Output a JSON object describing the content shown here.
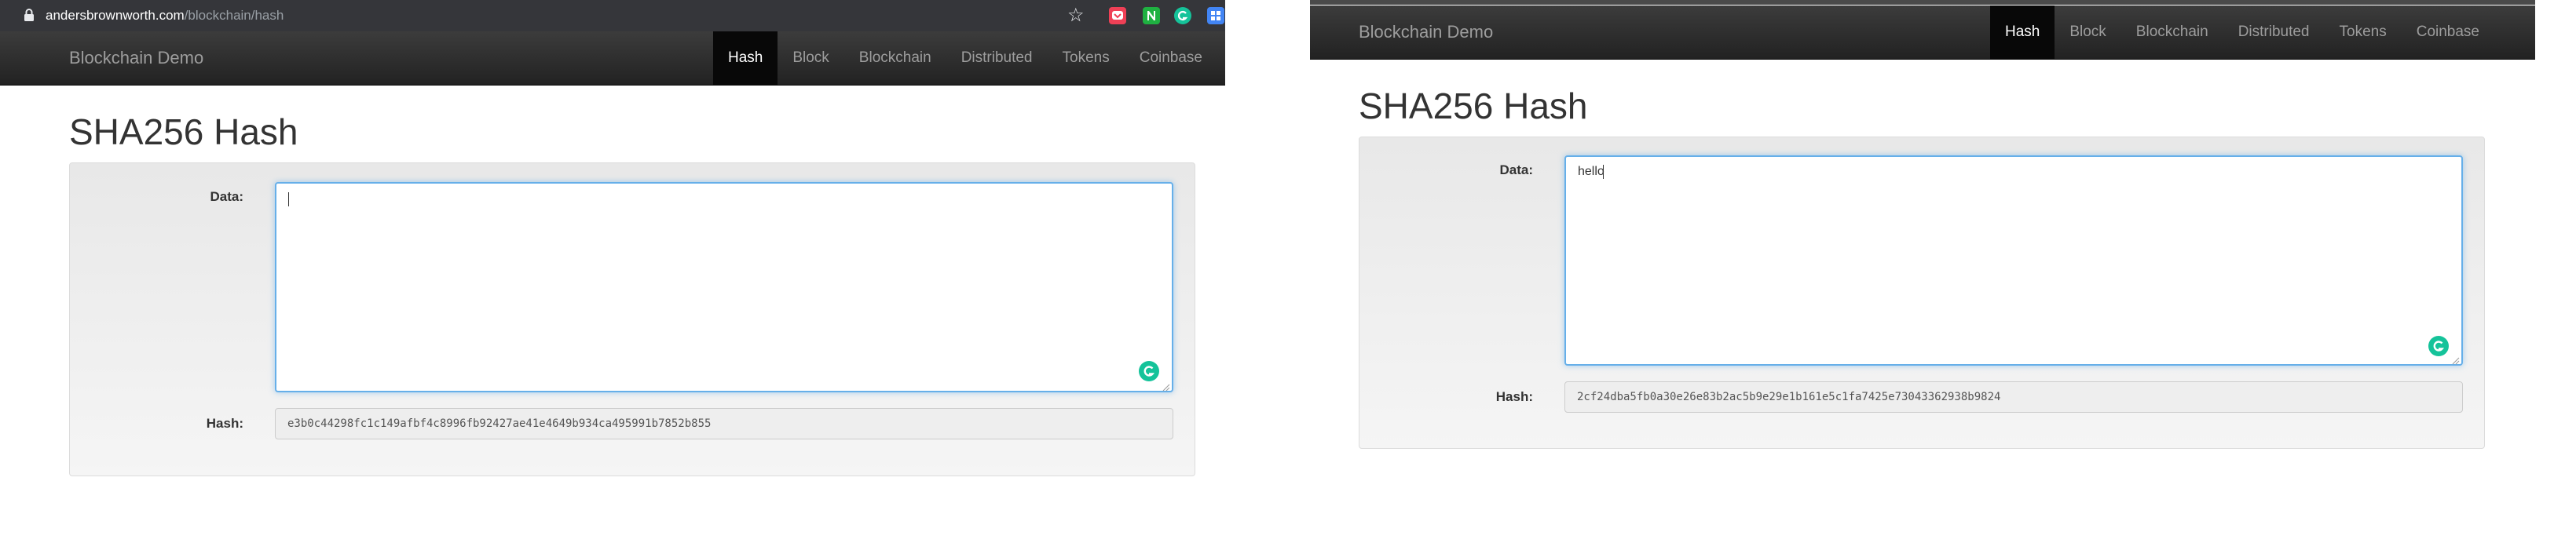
{
  "left": {
    "browser": {
      "url_host": "andersbrownworth.com",
      "url_path": "/blockchain/hash"
    },
    "navbar": {
      "brand": "Blockchain Demo",
      "items": [
        {
          "label": "Hash",
          "active": true
        },
        {
          "label": "Block"
        },
        {
          "label": "Blockchain"
        },
        {
          "label": "Distributed"
        },
        {
          "label": "Tokens"
        },
        {
          "label": "Coinbase"
        }
      ]
    },
    "page_title": "SHA256 Hash",
    "form": {
      "data_label": "Data:",
      "data_value": "",
      "hash_label": "Hash:",
      "hash_value": "e3b0c44298fc1c149afbf4c8996fb92427ae41e4649b934ca495991b7852b855"
    }
  },
  "right": {
    "navbar": {
      "brand": "Blockchain Demo",
      "items": [
        {
          "label": "Hash",
          "active": true
        },
        {
          "label": "Block"
        },
        {
          "label": "Blockchain"
        },
        {
          "label": "Distributed"
        },
        {
          "label": "Tokens"
        },
        {
          "label": "Coinbase"
        }
      ]
    },
    "page_title": "SHA256 Hash",
    "form": {
      "data_label": "Data:",
      "data_value": "hello",
      "hash_label": "Hash:",
      "hash_value": "2cf24dba5fb0a30e26e83b2ac5b9e29e1b161e5c1fa7425e73043362938b9824"
    }
  },
  "colors": {
    "navbar_bg": "#222222",
    "nav_active_bg": "#080808",
    "focus_border": "#66afe9",
    "grammarly_green": "#15c39a"
  },
  "icons": [
    "lock-icon",
    "star-icon",
    "pocket-extension-icon",
    "n-extension-icon",
    "grammarly-extension-icon",
    "ext-extension-icon",
    "grammarly-icon"
  ]
}
